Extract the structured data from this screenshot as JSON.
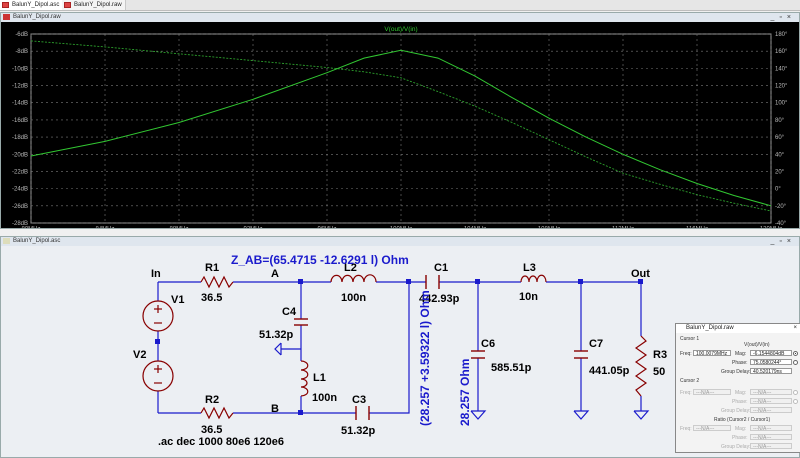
{
  "tabs": [
    {
      "label": "BalunY_Dipol.asc"
    },
    {
      "label": "BalunY_Dipol.raw"
    }
  ],
  "plot_window": {
    "title": "BalunY_Dipol.raw",
    "trace_label": "V(out)/V(in)"
  },
  "schematic_window": {
    "title": "BalunY_Dipol.asc"
  },
  "chart_data": {
    "type": "line",
    "x_ticks": [
      "80MHz",
      "84MHz",
      "88MHz",
      "92MHz",
      "96MHz",
      "100MHz",
      "104MHz",
      "108MHz",
      "112MHz",
      "116MHz",
      "120MHz"
    ],
    "y_left_ticks": [
      "-6dB",
      "-8dB",
      "-10dB",
      "-12dB",
      "-14dB",
      "-16dB",
      "-18dB",
      "-20dB",
      "-22dB",
      "-24dB",
      "-26dB",
      "-28dB"
    ],
    "y_right_ticks": [
      "180°",
      "160°",
      "140°",
      "120°",
      "100°",
      "80°",
      "60°",
      "40°",
      "20°",
      "0°",
      "-20°",
      "-40°"
    ],
    "ylim": [
      -28,
      -6
    ],
    "y2lim": [
      -40,
      180
    ],
    "xlim": [
      80,
      120
    ],
    "grid": true,
    "series": [
      {
        "name": "V(out)/V(in)",
        "x": [
          80,
          84,
          88,
          92,
          96,
          98,
          100,
          102,
          104,
          106,
          108,
          110,
          112,
          114,
          116,
          118,
          120
        ],
        "values": [
          -20.2,
          -18.5,
          -16.3,
          -13.6,
          -10.5,
          -8.8,
          -7.9,
          -8.8,
          -10.9,
          -13.4,
          -15.8,
          -18.0,
          -20.0,
          -21.8,
          -23.4,
          -24.8,
          -26.0
        ]
      },
      {
        "name": "phase",
        "x": [
          80,
          84,
          88,
          92,
          96,
          98,
          100,
          102,
          104,
          106,
          108,
          110,
          112,
          114,
          116,
          118,
          120
        ],
        "values": [
          172,
          165,
          157,
          149,
          141,
          136,
          129,
          113,
          96,
          77,
          57,
          37,
          18,
          5,
          -7,
          -17,
          -26
        ]
      }
    ]
  },
  "schematic": {
    "annotation_top": "Z_AB=(65.4715 -12.6291 l) Ohm",
    "annotation_vertical_1": "(28.257 +3.59322 l) Ohm",
    "annotation_vertical_2": "28.257 Ohm",
    "spice_directive": ".ac dec 1000 80e6 120e6",
    "labels": {
      "in": "In",
      "out": "Out",
      "a": "A",
      "b": "B"
    },
    "components": {
      "r1_name": "R1",
      "r1_value": "36.5",
      "r2_name": "R2",
      "r2_value": "36.5",
      "r3_name": "R3",
      "r3_value": "50",
      "v1_name": "V1",
      "v2_name": "V2",
      "l1_name": "L1",
      "l1_value": "100n",
      "l2_name": "L2",
      "l2_value": "100n",
      "l3_name": "L3",
      "l3_value": "10n",
      "c1_name": "C1",
      "c1_value": "442.93p",
      "c3_name": "C3",
      "c3_value": "51.32p",
      "c4_name": "C4",
      "c4_value": "51.32p",
      "c6_name": "C6",
      "c6_value": "585.51p",
      "c7_name": "C7",
      "c7_value": "441.05p"
    }
  },
  "cursor_dialog": {
    "title": "BalunY_Dipol.raw",
    "cursor1_label": "Cursor 1",
    "expr": "V(out)/V(in)",
    "freq_label": "Freq:",
    "freq_value": "100.0079MHz",
    "mag_label": "Mag:",
    "mag_value": "-6.1544804dB",
    "phase_label": "Phase:",
    "phase_value": "75.0580244°",
    "gd_label": "Group Delay:",
    "gd_value": "40.520179ns",
    "cursor2_label": "Cursor 2",
    "na": "---N/A---",
    "ratio_label": "Ratio (Cursor2 / Cursor1)"
  }
}
